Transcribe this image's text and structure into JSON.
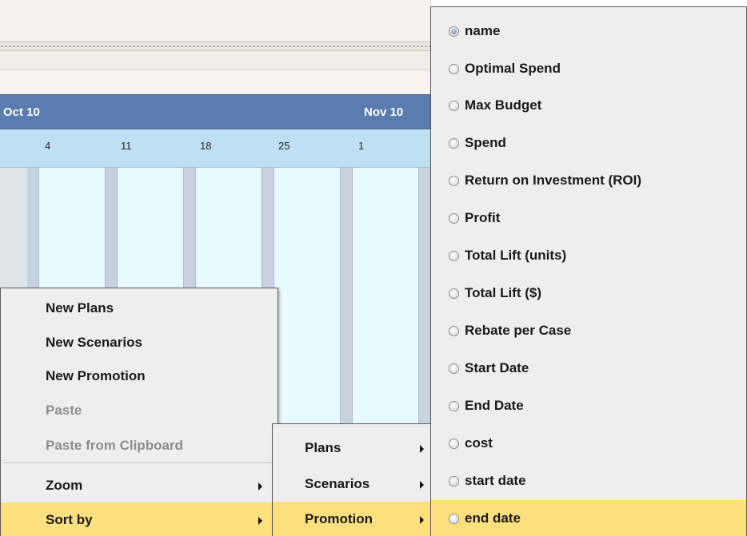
{
  "calendar": {
    "months": [
      {
        "label": "Oct 10"
      },
      {
        "label": "Nov 10"
      }
    ],
    "weeks": [
      "4",
      "11",
      "18",
      "25",
      "1"
    ]
  },
  "context_menu": {
    "items": [
      {
        "label": "New Plans",
        "enabled": true
      },
      {
        "label": "New Scenarios",
        "enabled": true
      },
      {
        "label": "New Promotion",
        "enabled": true
      },
      {
        "label": "Paste",
        "enabled": false
      },
      {
        "label": "Paste from Clipboard",
        "enabled": false
      },
      {
        "label": "Zoom",
        "enabled": true,
        "has_submenu": true
      },
      {
        "label": "Sort by",
        "enabled": true,
        "has_submenu": true,
        "highlighted": true
      }
    ]
  },
  "sort_by_menu": {
    "items": [
      {
        "label": "Plans",
        "has_submenu": true
      },
      {
        "label": "Scenarios",
        "has_submenu": true
      },
      {
        "label": "Promotion",
        "has_submenu": true,
        "highlighted": true
      }
    ]
  },
  "sort_field_menu": {
    "items": [
      {
        "label": "name",
        "selected": true
      },
      {
        "label": "Optimal Spend",
        "selected": false
      },
      {
        "label": "Max Budget",
        "selected": false
      },
      {
        "label": "Spend",
        "selected": false
      },
      {
        "label": "Return on Investment (ROI)",
        "selected": false
      },
      {
        "label": "Profit",
        "selected": false
      },
      {
        "label": "Total Lift (units)",
        "selected": false
      },
      {
        "label": "Total Lift ($)",
        "selected": false
      },
      {
        "label": "Rebate per Case",
        "selected": false
      },
      {
        "label": "Start Date",
        "selected": false
      },
      {
        "label": "End Date",
        "selected": false
      },
      {
        "label": "cost",
        "selected": false
      },
      {
        "label": "start date",
        "selected": false
      },
      {
        "label": "end date",
        "selected": false,
        "highlighted": true
      }
    ]
  },
  "colors": {
    "menu_highlight": "#fcdf7e",
    "month_header": "#5a7cae",
    "week_header": "#bfdff2",
    "day_cell": "#e8fafd",
    "radio_selected": "#6e93c3"
  }
}
